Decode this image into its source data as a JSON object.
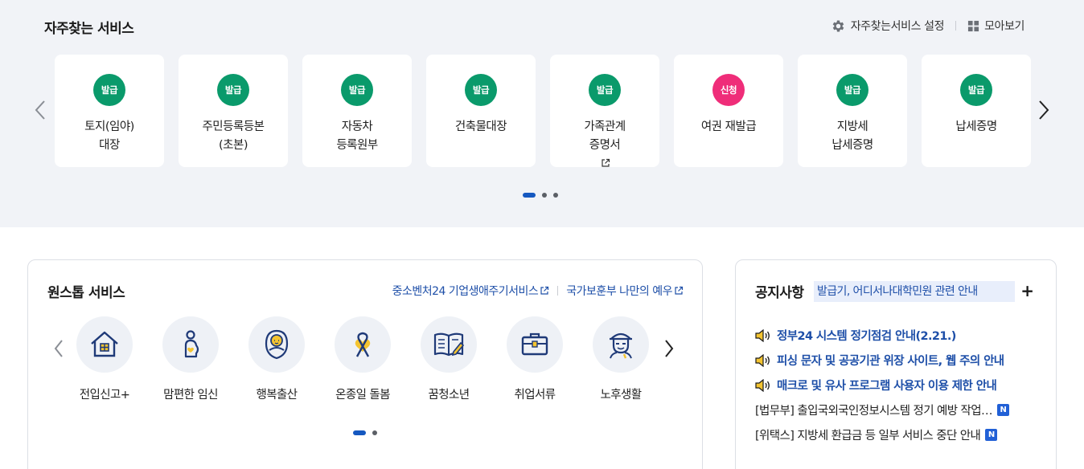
{
  "frequent": {
    "title": "자주찾는 서비스",
    "settings_label": "자주찾는서비스 설정",
    "viewall_label": "모아보기",
    "cards": [
      {
        "badge": "발급",
        "badge_color": "#0a9a6b",
        "line1": "토지(임야)",
        "line2": "대장",
        "external": false
      },
      {
        "badge": "발급",
        "badge_color": "#0a9a6b",
        "line1": "주민등록등본",
        "line2": "(초본)",
        "external": false
      },
      {
        "badge": "발급",
        "badge_color": "#0a9a6b",
        "line1": "자동차",
        "line2": "등록원부",
        "external": false
      },
      {
        "badge": "발급",
        "badge_color": "#0a9a6b",
        "line1": "건축물대장",
        "line2": "",
        "external": false
      },
      {
        "badge": "발급",
        "badge_color": "#0a9a6b",
        "line1": "가족관계",
        "line2": "증명서",
        "external": true
      },
      {
        "badge": "신청",
        "badge_color": "#ef2d79",
        "line1": "여권 재발급",
        "line2": "",
        "external": false
      },
      {
        "badge": "발급",
        "badge_color": "#0a9a6b",
        "line1": "지방세",
        "line2": "납세증명",
        "external": false
      },
      {
        "badge": "발급",
        "badge_color": "#0a9a6b",
        "line1": "납세증명",
        "line2": "",
        "external": false
      }
    ],
    "page_count": 3,
    "active_page": 1
  },
  "onestop": {
    "title": "원스톱 서비스",
    "link1": "중소벤처24 기업생애주기서비스",
    "link2": "국가보훈부 나만의 예우",
    "items": [
      {
        "label": "전입신고+",
        "icon": "house-icon"
      },
      {
        "label": "맘편한 임신",
        "icon": "pregnancy-icon"
      },
      {
        "label": "행복출산",
        "icon": "baby-icon"
      },
      {
        "label": "온종일 돌봄",
        "icon": "ribbon-heart-icon"
      },
      {
        "label": "꿈청소년",
        "icon": "book-pencil-icon"
      },
      {
        "label": "취업서류",
        "icon": "briefcase-icon"
      },
      {
        "label": "노후생활",
        "icon": "elder-icon"
      }
    ],
    "page_count": 2,
    "active_page": 1
  },
  "notice": {
    "title": "공지사항",
    "highlight": "발급기, 어디서나대학민원 관련 안내",
    "more_label": "+",
    "items": [
      {
        "text": "정부24 시스템 정기점검 안내(2.21.)",
        "important": true,
        "new": false
      },
      {
        "text": "피싱 문자 및 공공기관 위장 사이트, 웹 주의 안내",
        "important": true,
        "new": false
      },
      {
        "text": "매크로 및 유사 프로그램 사용자 이용 제한 안내",
        "important": true,
        "new": false
      },
      {
        "text": "[법무부] 출입국외국인정보시스템 정기 예방 작업…",
        "important": false,
        "new": true
      },
      {
        "text": "[위택스] 지방세 환급금 등 일부 서비스 중단 안내",
        "important": false,
        "new": true
      }
    ],
    "new_badge": "N"
  },
  "colors": {
    "accent_blue": "#1e4fa8",
    "issue_green": "#0a9a6b",
    "apply_pink": "#ef2d79",
    "icon_navy": "#1f3a78",
    "icon_yellow": "#f4c430"
  }
}
